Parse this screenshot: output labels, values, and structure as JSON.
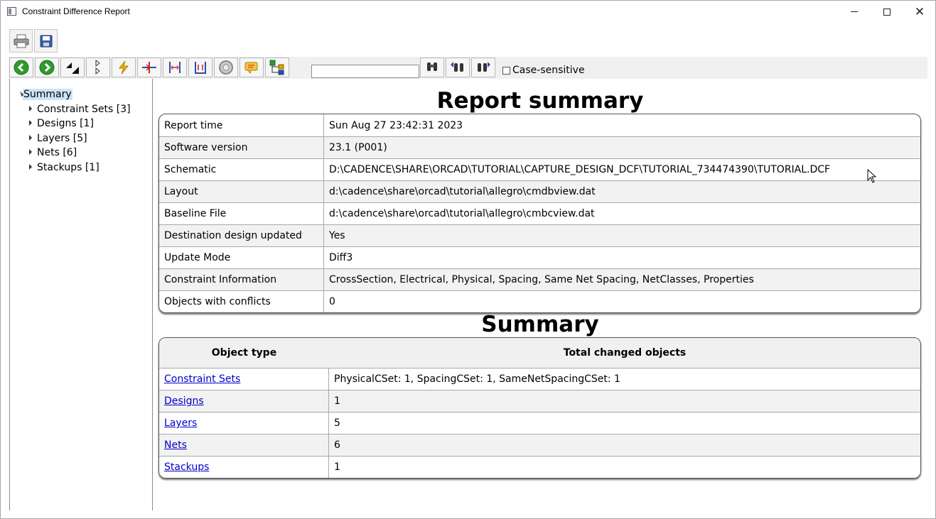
{
  "window": {
    "title": "Constraint Difference Report",
    "controls": {
      "minimize": "minimize",
      "maximize": "maximize",
      "close": "close"
    }
  },
  "toolbar_main": [
    {
      "icon": "printer-icon"
    },
    {
      "icon": "save-icon"
    }
  ],
  "toolbar_nav": [
    {
      "icon": "back-arrow-icon",
      "color": "#2e9b2e"
    },
    {
      "icon": "forward-arrow-icon",
      "color": "#2e9b2e"
    },
    {
      "icon": "collapse-all-icon"
    },
    {
      "icon": "expand-all-icon"
    },
    {
      "icon": "electrical-icon",
      "color": "#e6a700"
    },
    {
      "icon": "physical-icon",
      "color": "#d02020"
    },
    {
      "icon": "spacing-icon",
      "color": "#2a4fa8"
    },
    {
      "icon": "same-net-spacing-icon",
      "color": "#2a4fa8"
    },
    {
      "icon": "properties-icon",
      "color": "#9a9a9a"
    },
    {
      "icon": "netclass-icon",
      "color": "#e0a000"
    },
    {
      "icon": "tree-view-icon",
      "color": "#2e9b2e"
    }
  ],
  "search": {
    "value": "",
    "case_sensitive_label": "Case-sensitive",
    "case_sensitive_checked": false
  },
  "tree": {
    "root": "Summary",
    "items": [
      {
        "label": "Constraint Sets [3]"
      },
      {
        "label": "Designs [1]"
      },
      {
        "label": "Layers [5]"
      },
      {
        "label": "Nets [6]"
      },
      {
        "label": "Stackups [1]"
      }
    ]
  },
  "report": {
    "heading": "Report summary",
    "rows": [
      {
        "key": "Report time",
        "value": "Sun Aug 27 23:42:31 2023"
      },
      {
        "key": "Software version",
        "value": "23.1 (P001)"
      },
      {
        "key": "Schematic",
        "value": "D:\\CADENCE\\SHARE\\ORCAD\\TUTORIAL\\CAPTURE_DESIGN_DCF\\TUTORIAL_734474390\\TUTORIAL.DCF"
      },
      {
        "key": "Layout",
        "value": "d:\\cadence\\share\\orcad\\tutorial\\allegro\\cmdbview.dat"
      },
      {
        "key": "Baseline File",
        "value": "d:\\cadence\\share\\orcad\\tutorial\\allegro\\cmbcview.dat"
      },
      {
        "key": "Destination design updated",
        "value": "Yes"
      },
      {
        "key": "Update Mode",
        "value": "Diff3"
      },
      {
        "key": "Constraint Information",
        "value": "CrossSection, Electrical, Physical, Spacing, Same Net Spacing, NetClasses, Properties"
      },
      {
        "key": "Objects with conflicts",
        "value": "0"
      }
    ]
  },
  "summary": {
    "heading": "Summary",
    "col_type": "Object type",
    "col_total": "Total changed objects",
    "rows": [
      {
        "type": "Constraint Sets",
        "total": "PhysicalCSet: 1, SpacingCSet: 1, SameNetSpacingCSet: 1"
      },
      {
        "type": "Designs",
        "total": "1"
      },
      {
        "type": "Layers",
        "total": "5"
      },
      {
        "type": "Nets",
        "total": "6"
      },
      {
        "type": "Stackups",
        "total": "1"
      }
    ]
  }
}
